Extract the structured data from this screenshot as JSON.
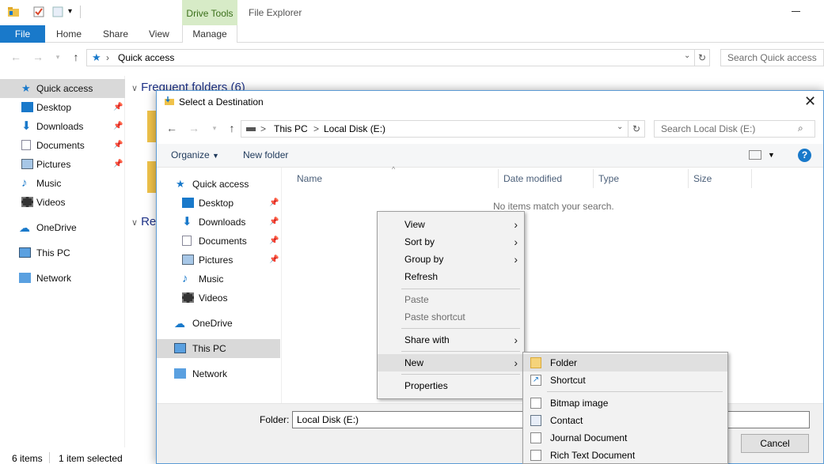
{
  "explorer": {
    "window_title": "File Explorer",
    "drive_tools": "Drive Tools",
    "ribbon": {
      "file": "File",
      "home": "Home",
      "share": "Share",
      "view": "View",
      "manage": "Manage"
    },
    "address": {
      "crumb_sep": "›",
      "location": "Quick access",
      "search_placeholder": "Search Quick access"
    },
    "sidebar": {
      "quick_access": "Quick access",
      "items": [
        {
          "label": "Desktop",
          "pinned": true
        },
        {
          "label": "Downloads",
          "pinned": true
        },
        {
          "label": "Documents",
          "pinned": true
        },
        {
          "label": "Pictures",
          "pinned": true
        },
        {
          "label": "Music",
          "pinned": false
        },
        {
          "label": "Videos",
          "pinned": false
        }
      ],
      "onedrive": "OneDrive",
      "this_pc": "This PC",
      "network": "Network"
    },
    "frequent_folders": "Frequent folders (6)",
    "recent_files_partial": "Re",
    "status": {
      "items": "6 items",
      "selected": "1 item selected"
    }
  },
  "dialog": {
    "title": "Select a Destination",
    "address": {
      "this_pc": "This PC",
      "sep": ">",
      "local_disk": "Local Disk (E:)",
      "search_placeholder": "Search Local Disk (E:)"
    },
    "toolbar": {
      "organize": "Organize",
      "new_folder": "New folder",
      "help": "?"
    },
    "sidebar": {
      "quick_access": "Quick access",
      "items": [
        "Desktop",
        "Downloads",
        "Documents",
        "Pictures",
        "Music",
        "Videos"
      ],
      "onedrive": "OneDrive",
      "this_pc": "This PC",
      "network": "Network"
    },
    "columns": {
      "name": "Name",
      "date_modified": "Date modified",
      "type": "Type",
      "size": "Size"
    },
    "empty_message": "No items match your search.",
    "folder_label": "Folder:",
    "folder_value": "Local Disk (E:)",
    "cancel": "Cancel"
  },
  "context_menu": {
    "view": "View",
    "sort_by": "Sort by",
    "group_by": "Group by",
    "refresh": "Refresh",
    "paste": "Paste",
    "paste_shortcut": "Paste shortcut",
    "share_with": "Share with",
    "new": "New",
    "properties": "Properties"
  },
  "new_submenu": {
    "folder": "Folder",
    "shortcut": "Shortcut",
    "bitmap": "Bitmap image",
    "contact": "Contact",
    "journal": "Journal Document",
    "rtf": "Rich Text Document"
  },
  "colors": {
    "accent": "#1979ca",
    "drive_tools_bg": "#d7ebc7",
    "header_blue": "#1e3287"
  }
}
